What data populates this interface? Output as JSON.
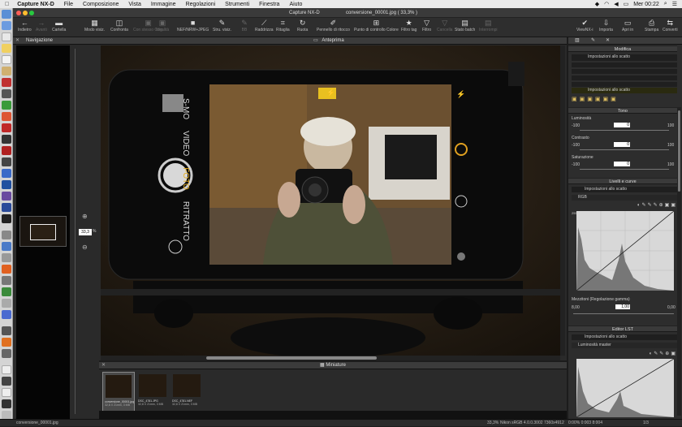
{
  "menubar": {
    "app": "Capture NX-D",
    "items": [
      "File",
      "Composizione",
      "Vista",
      "Immagine",
      "Regolazioni",
      "Strumenti",
      "Finestra",
      "Aiuto"
    ],
    "clock": "Mer 00:22"
  },
  "window": {
    "title": "conversione_00001.jpg ( 33,3% )",
    "app_name": "Capture NX-D"
  },
  "toolbar": {
    "items": [
      {
        "label": "Indietro",
        "icon": "arrow-left"
      },
      {
        "label": "Avanti",
        "icon": "arrow-right",
        "disabled": true
      },
      {
        "label": "Cartella",
        "icon": "folder"
      },
      {
        "label": "Modo visiz.",
        "icon": "view-mode"
      },
      {
        "label": "Confronta",
        "icon": "compare"
      },
      {
        "label": "Con stesso Orig.",
        "icon": "same-orig",
        "disabled": true
      },
      {
        "label": "Idealità",
        "icon": "ideal",
        "disabled": true
      },
      {
        "label": "NEF/NRW+JPEG",
        "icon": "nef-jpeg"
      },
      {
        "label": "Stru. visiz.",
        "icon": "view-tools"
      },
      {
        "label": "BB",
        "icon": "bb",
        "disabled": true
      },
      {
        "label": "Raddrizza",
        "icon": "straighten"
      },
      {
        "label": "Ritaglia",
        "icon": "crop"
      },
      {
        "label": "Ruota",
        "icon": "rotate"
      },
      {
        "label": "Pennello di ritocco",
        "icon": "brush"
      },
      {
        "label": "Punto di controllo Colore",
        "icon": "color-point"
      },
      {
        "label": "Filtro tag",
        "icon": "star"
      },
      {
        "label": "Filtro",
        "icon": "filter"
      },
      {
        "label": "Cancella",
        "icon": "delete",
        "disabled": true
      },
      {
        "label": "Stato batch",
        "icon": "batch"
      },
      {
        "label": "Interrompi",
        "icon": "stop",
        "disabled": true
      },
      {
        "label": "ViewNX-i",
        "icon": "viewnx"
      },
      {
        "label": "Importa",
        "icon": "import"
      },
      {
        "label": "Apri in",
        "icon": "open-in"
      },
      {
        "label": "Stampa",
        "icon": "print"
      },
      {
        "label": "Converti",
        "icon": "convert"
      }
    ]
  },
  "panels": {
    "navigation": "Navigazione",
    "preview": "Anteprima",
    "thumbnails": "Miniature",
    "adjust": "Modifica"
  },
  "zoom": {
    "value": "33,3",
    "unit": "%"
  },
  "phone_ui": {
    "modes": [
      "VIDEO",
      "FOTO",
      "RITRATTO"
    ],
    "top_mode": "S-MO"
  },
  "adjust": {
    "preset": "Impostazioni allo scatto",
    "preset2": "Impostazioni allo scatto",
    "tone_title": "Tono",
    "luminosity": {
      "label": "Luminosità",
      "min": "-100",
      "max": "100",
      "value": "0"
    },
    "contrast": {
      "label": "Contrasto",
      "min": "-100",
      "max": "100",
      "value": "0"
    },
    "saturation": {
      "label": "Saturazione",
      "min": "-100",
      "max": "100",
      "value": "0"
    },
    "levels_title": "Livelli e curve",
    "levels_preset": "Impostazioni allo scatto",
    "channel": "RGB",
    "hist_max": "255",
    "midtones_label": "Mezzitoni (Regolazione gamma)",
    "midtones": {
      "min": "0,00",
      "value": "1,00",
      "max": "0,00",
      "left": "8,00"
    },
    "lst_title": "Editor LST",
    "lst_preset": "Impostazioni allo scatto",
    "lst_channel": "Luminosità master"
  },
  "thumbs": [
    {
      "name": "conversione_00001.jpg",
      "info": "32,8 X 21mm, 3 MB"
    },
    {
      "name": "DSC_4781.JPG",
      "info": "32,8 X 21mm, 3 MB"
    },
    {
      "name": "DSC_4781.NEF",
      "info": "32,8 X 21mm, 3 MB"
    }
  ],
  "status": {
    "filename": "conversione_00001.jpg",
    "zoom": "33,3%",
    "profile": "Nikon sRGB 4.0.0.3002",
    "dims": "7360x4912",
    "coords": "0:00% 0:003 8:004",
    "page": "1/3"
  }
}
